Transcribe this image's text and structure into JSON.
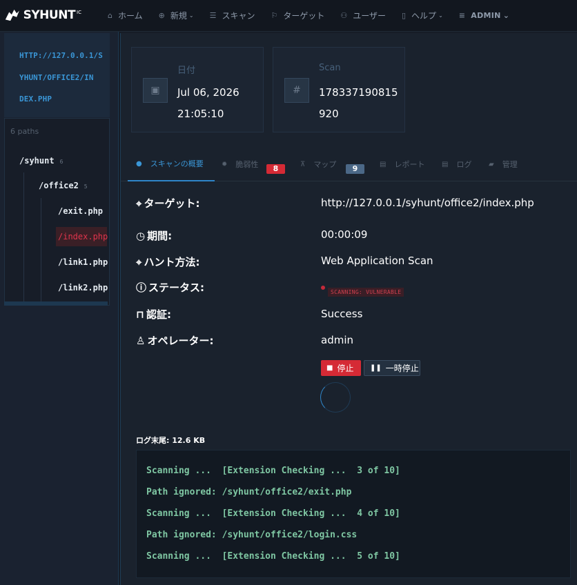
{
  "brand": {
    "name": "SYHUNT",
    "mark": "IC"
  },
  "nav": [
    {
      "icon": "home-icon",
      "glyph": "⌂",
      "label": "ホーム",
      "caret": ""
    },
    {
      "icon": "plus-circle-icon",
      "glyph": "⊕",
      "label": "新規",
      "caret": "⌄"
    },
    {
      "icon": "list-icon",
      "glyph": "☰",
      "label": "スキャン",
      "caret": ""
    },
    {
      "icon": "bookmark-icon",
      "glyph": "⚐",
      "label": "ターゲット",
      "caret": ""
    },
    {
      "icon": "users-icon",
      "glyph": "⚇",
      "label": "ユーザー",
      "caret": ""
    },
    {
      "icon": "book-icon",
      "glyph": "▯",
      "label": "ヘルプ",
      "caret": "⌄"
    },
    {
      "icon": "menu-icon",
      "glyph": "≡",
      "label": "ADMIN",
      "caret": "⌄"
    }
  ],
  "sidebar": {
    "url_lines": [
      "HTTP://127.0.0.1/S",
      "YHUNT/OFFICE2/IN",
      "DEX.PHP"
    ],
    "paths_count": "6 paths",
    "tree": {
      "root": {
        "label": "/syhunt",
        "count": "6"
      },
      "child": {
        "label": "/office2",
        "count": "5"
      },
      "leaves": [
        "/exit.php",
        "/index.php",
        "/link1.php",
        "/link2.php"
      ]
    }
  },
  "cards": {
    "date": {
      "icon": "calendar-icon",
      "glyph": "▣",
      "label": "日付",
      "value": "Jul 06, 2026\n21:05:10"
    },
    "scan": {
      "icon": "hash-icon",
      "glyph": "#",
      "label": "Scan",
      "value": "178337190815\n920"
    }
  },
  "tabs": [
    {
      "icon": "info-icon",
      "glyph": "●",
      "label": "スキャンの概要",
      "badge": ""
    },
    {
      "icon": "bug-icon",
      "glyph": "✹",
      "label": "脆弱性",
      "badge": "8"
    },
    {
      "icon": "sitemap-icon",
      "glyph": "⊼",
      "label": "マップ",
      "badge": "9"
    },
    {
      "icon": "file-icon",
      "glyph": "▤",
      "label": "レポート",
      "badge": ""
    },
    {
      "icon": "file-log-icon",
      "glyph": "▤",
      "label": "ログ",
      "badge": ""
    },
    {
      "icon": "briefcase-icon",
      "glyph": "▰",
      "label": "管理",
      "badge": ""
    }
  ],
  "fields": {
    "target": {
      "icon": "crosshair-icon",
      "glyph": "⌖",
      "label": "ターゲット:",
      "value": "http://127.0.0.1/syhunt/office2/index.php"
    },
    "duration": {
      "icon": "clock-icon",
      "glyph": "◷",
      "label": "期間:",
      "value": "00:00:09"
    },
    "method": {
      "icon": "crosshair-icon",
      "glyph": "⌖",
      "label": "ハント方法:",
      "value": "Web Application Scan"
    },
    "status": {
      "icon": "info-circle-icon",
      "glyph": "ⓘ",
      "label": "ステータス:",
      "value": "SCANNING: VULNERABLE"
    },
    "auth": {
      "icon": "lock-icon",
      "glyph": "⊓",
      "label": "認証:",
      "value": "Success"
    },
    "operator": {
      "icon": "user-icon",
      "glyph": "♙",
      "label": "オペレーター:",
      "value": "admin"
    }
  },
  "actions": {
    "stop": "停止",
    "pause": "一時停止"
  },
  "log": {
    "tail_label": "ログ末尾: 12.6 KB",
    "lines": [
      "Scanning ...  [Extension Checking ...  3 of 10]",
      "Path ignored: /syhunt/office2/exit.php",
      "Scanning ...  [Extension Checking ...  4 of 10]",
      "Path ignored: /syhunt/office2/login.css",
      "Scanning ...  [Extension Checking ...  5 of 10]"
    ]
  }
}
